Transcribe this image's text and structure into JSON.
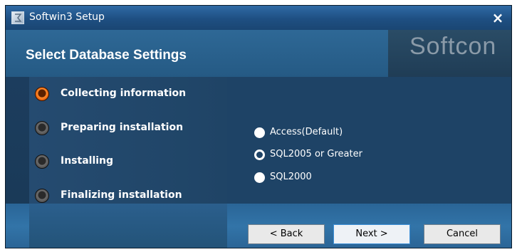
{
  "window": {
    "title": "Softwin3 Setup",
    "close_label": "×"
  },
  "header": {
    "title": "Select Database Settings",
    "logo_text": "Softcon"
  },
  "steps": [
    {
      "label": "Collecting information",
      "active": true
    },
    {
      "label": "Preparing installation",
      "active": false
    },
    {
      "label": "Installing",
      "active": false
    },
    {
      "label": "Finalizing installation",
      "active": false
    }
  ],
  "database_options": [
    {
      "label": "Access(Default)",
      "selected": false
    },
    {
      "label": "SQL2005 or Greater",
      "selected": true
    },
    {
      "label": "SQL2000",
      "selected": false
    }
  ],
  "buttons": {
    "back": "< Back",
    "next": "Next >",
    "cancel": "Cancel"
  },
  "colors": {
    "active_step": "#ff8a2a",
    "title_bar": "#2f6aa5",
    "panel": "#1e4366"
  }
}
